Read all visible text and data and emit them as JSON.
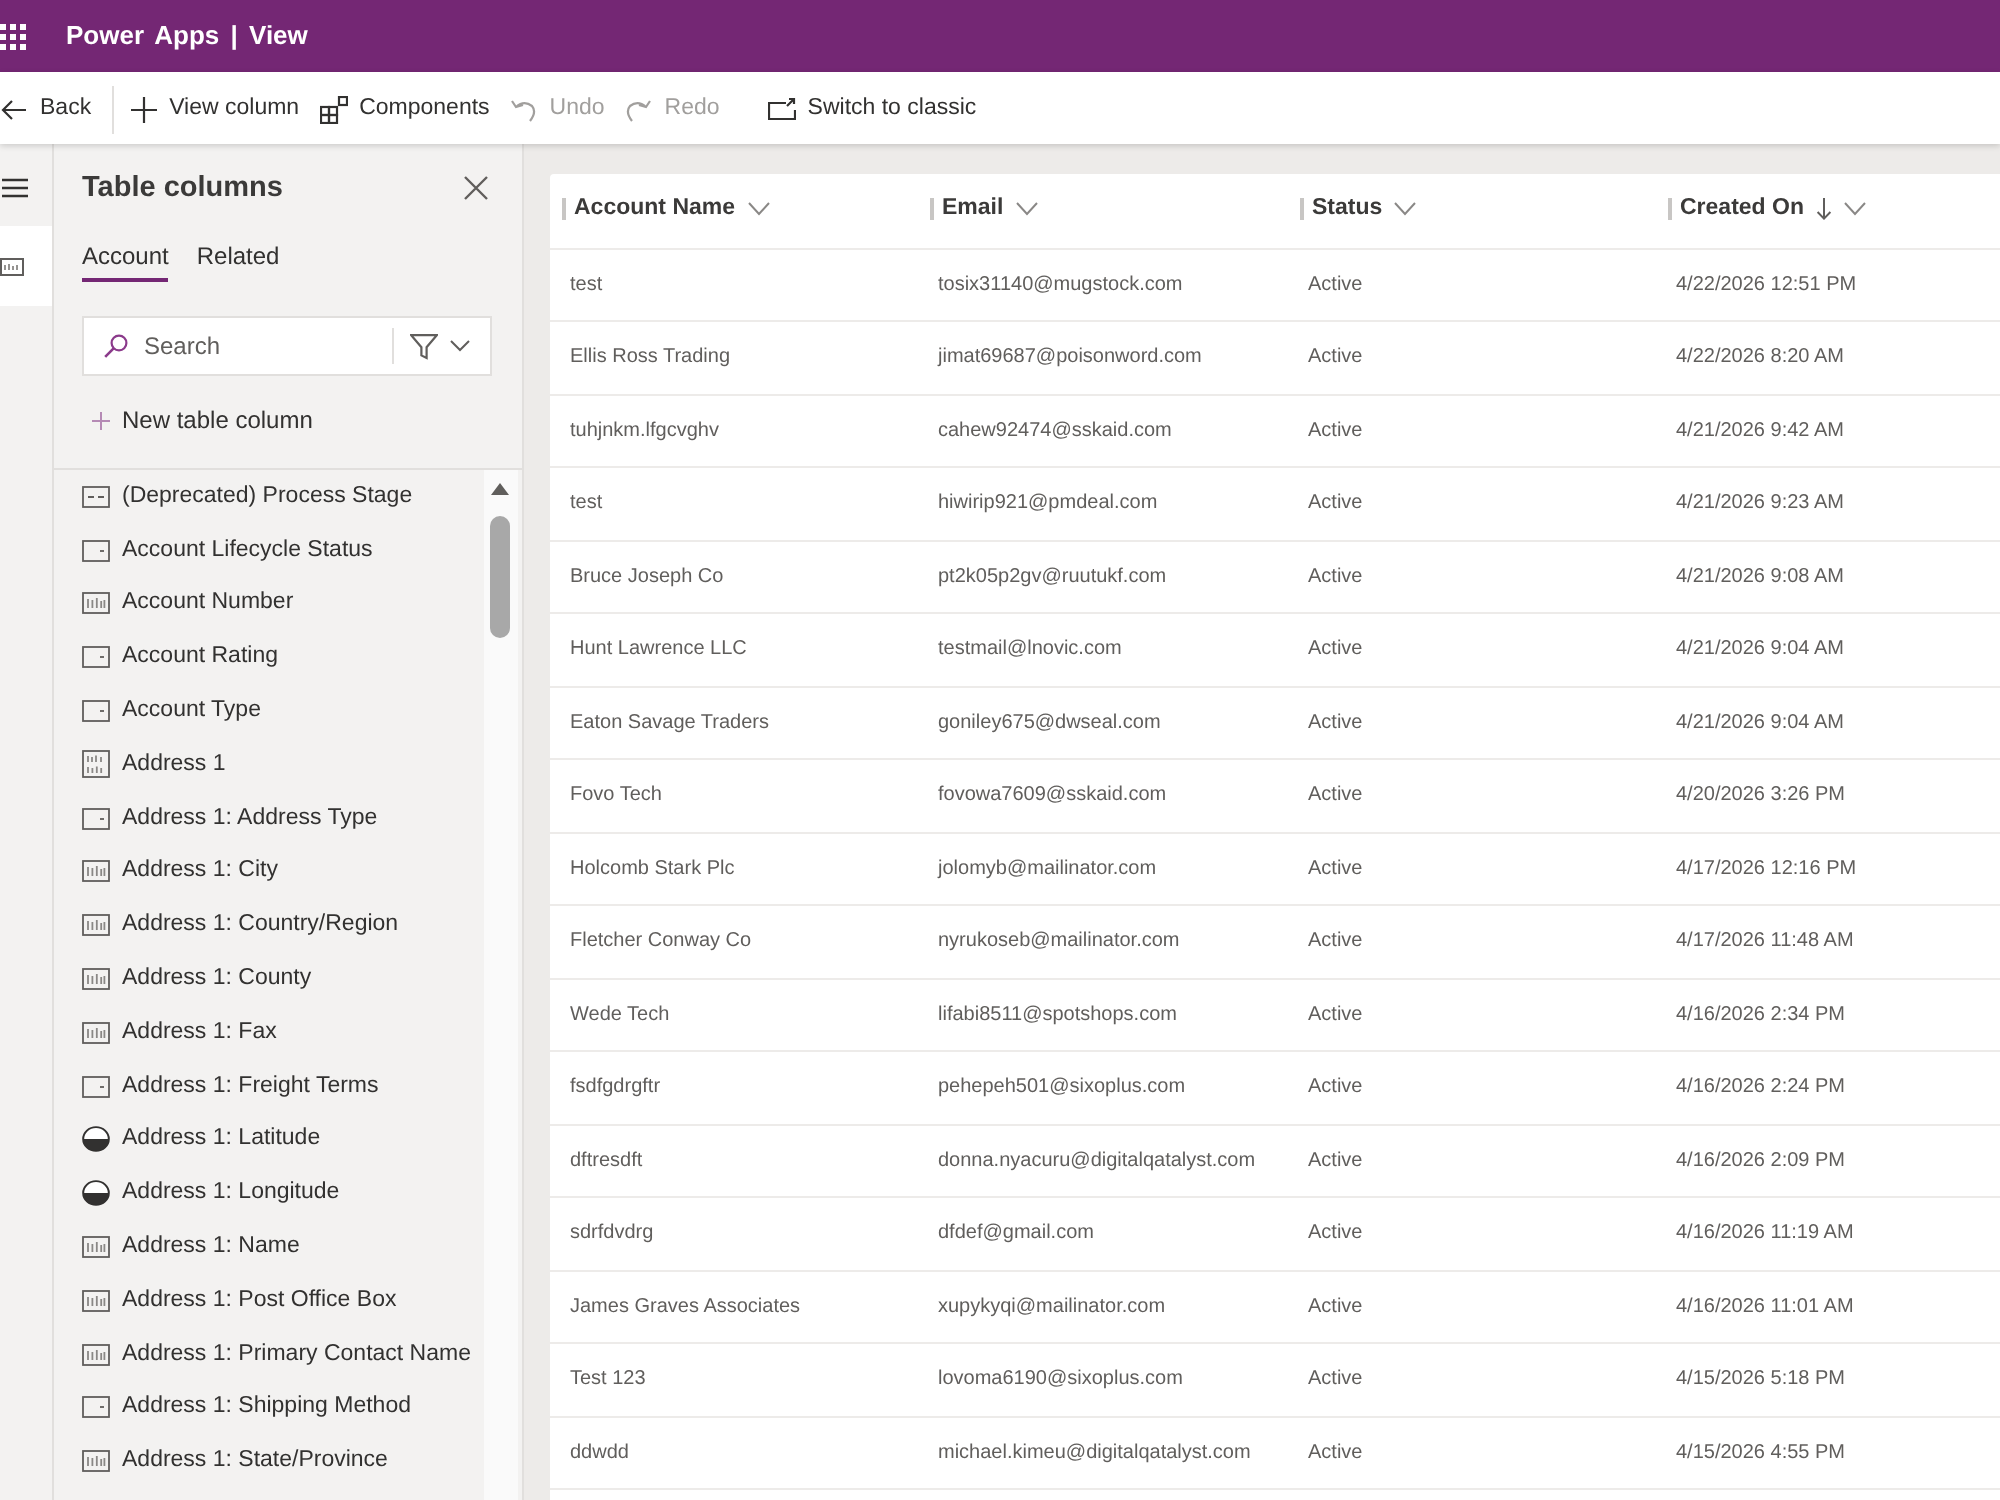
{
  "top_bar": {
    "title": "Power Apps | View"
  },
  "command_bar": {
    "items": [
      {
        "label": "Back",
        "disabled": false
      },
      {
        "label": "View column",
        "disabled": false
      },
      {
        "label": "Components",
        "disabled": false
      },
      {
        "label": "Undo",
        "disabled": true
      },
      {
        "label": "Redo",
        "disabled": true
      },
      {
        "label": "Switch to classic",
        "disabled": false
      }
    ]
  },
  "rail": {
    "items": [
      {
        "selected": true
      }
    ]
  },
  "panel": {
    "title": "Table columns",
    "tabs": [
      {
        "label": "Account",
        "selected": true
      },
      {
        "label": "Related",
        "selected": false
      }
    ],
    "search": {
      "placeholder": "Search"
    },
    "new_column": "New table column",
    "columns": [
      {
        "label": "(Deprecated) Process Stage",
        "kind": "process"
      },
      {
        "label": "Account Lifecycle Status",
        "kind": "choice"
      },
      {
        "label": "Account Number",
        "kind": "text"
      },
      {
        "label": "Account Rating",
        "kind": "choice"
      },
      {
        "label": "Account Type",
        "kind": "choice"
      },
      {
        "label": "Address 1",
        "kind": "multiline"
      },
      {
        "label": "Address 1: Address Type",
        "kind": "choice"
      },
      {
        "label": "Address 1: City",
        "kind": "text"
      },
      {
        "label": "Address 1: Country/Region",
        "kind": "text"
      },
      {
        "label": "Address 1: County",
        "kind": "text"
      },
      {
        "label": "Address 1: Fax",
        "kind": "text"
      },
      {
        "label": "Address 1: Freight Terms",
        "kind": "choice"
      },
      {
        "label": "Address 1: Latitude",
        "kind": "decimal"
      },
      {
        "label": "Address 1: Longitude",
        "kind": "decimal"
      },
      {
        "label": "Address 1: Name",
        "kind": "text"
      },
      {
        "label": "Address 1: Post Office Box",
        "kind": "text"
      },
      {
        "label": "Address 1: Primary Contact Name",
        "kind": "text"
      },
      {
        "label": "Address 1: Shipping Method",
        "kind": "choice"
      },
      {
        "label": "Address 1: State/Province",
        "kind": "text"
      }
    ]
  },
  "table": {
    "columns": [
      {
        "label": "Account Name",
        "sorted": false
      },
      {
        "label": "Email",
        "sorted": false
      },
      {
        "label": "Status",
        "sorted": false
      },
      {
        "label": "Created On",
        "sorted": true
      }
    ],
    "rows": [
      [
        "test",
        "tosix31140@mugstock.com",
        "Active",
        "4/22/2026 12:51 PM"
      ],
      [
        "Ellis Ross Trading",
        "jimat69687@poisonword.com",
        "Active",
        "4/22/2026 8:20 AM"
      ],
      [
        "tuhjnkm.lfgcvghv",
        "cahew92474@sskaid.com",
        "Active",
        "4/21/2026 9:42 AM"
      ],
      [
        "test",
        "hiwirip921@pmdeal.com",
        "Active",
        "4/21/2026 9:23 AM"
      ],
      [
        "Bruce Joseph Co",
        "pt2k05p2gv@ruutukf.com",
        "Active",
        "4/21/2026 9:08 AM"
      ],
      [
        "Hunt Lawrence LLC",
        "testmail@lnovic.com",
        "Active",
        "4/21/2026 9:04 AM"
      ],
      [
        "Eaton Savage Traders",
        "goniley675@dwseal.com",
        "Active",
        "4/21/2026 9:04 AM"
      ],
      [
        "Fovo Tech",
        "fovowa7609@sskaid.com",
        "Active",
        "4/20/2026 3:26 PM"
      ],
      [
        "Holcomb Stark Plc",
        "jolomyb@mailinator.com",
        "Active",
        "4/17/2026 12:16 PM"
      ],
      [
        "Fletcher Conway Co",
        "nyrukoseb@mailinator.com",
        "Active",
        "4/17/2026 11:48 AM"
      ],
      [
        "Wede Tech",
        "lifabi8511@spotshops.com",
        "Active",
        "4/16/2026 2:34 PM"
      ],
      [
        "fsdfgdrgftr",
        "pehepeh501@sixoplus.com",
        "Active",
        "4/16/2026 2:24 PM"
      ],
      [
        "dftresdft",
        "donna.nyacuru@digitalqatalyst.com",
        "Active",
        "4/16/2026 2:09 PM"
      ],
      [
        "sdrfdvdrg",
        "dfdef@gmail.com",
        "Active",
        "4/16/2026 11:19 AM"
      ],
      [
        "James Graves Associates",
        "xupykyqi@mailinator.com",
        "Active",
        "4/16/2026 11:01 AM"
      ],
      [
        "Test 123",
        "lovoma6190@sixoplus.com",
        "Active",
        "4/15/2026 5:18 PM"
      ],
      [
        "ddwdd",
        "michael.kimeu@digitalqatalyst.com",
        "Active",
        "4/15/2026 4:55 PM"
      ]
    ]
  }
}
